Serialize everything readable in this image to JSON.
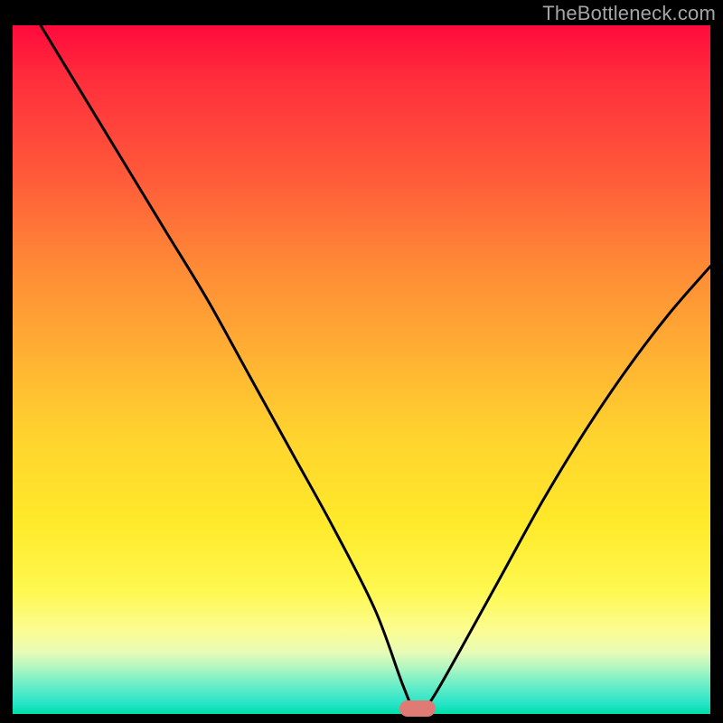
{
  "watermark": {
    "text": "TheBottleneck.com"
  },
  "chart_data": {
    "type": "line",
    "title": "",
    "xlabel": "",
    "ylabel": "",
    "xlim": [
      0,
      1
    ],
    "ylim": [
      0,
      1
    ],
    "grid": false,
    "legend": false,
    "background_gradient_meaning": "bottleneck-severity (red=high, green=none)",
    "marker": {
      "x": 0.58,
      "y": 0.0,
      "shape": "pill",
      "color": "#e07a74"
    },
    "series": [
      {
        "name": "bottleneck-curve",
        "x": [
          0.04,
          0.1,
          0.16,
          0.22,
          0.28,
          0.34,
          0.4,
          0.46,
          0.52,
          0.56,
          0.58,
          0.6,
          0.64,
          0.7,
          0.76,
          0.82,
          0.88,
          0.94,
          1.0
        ],
        "y": [
          1.0,
          0.9,
          0.8,
          0.7,
          0.6,
          0.49,
          0.38,
          0.27,
          0.15,
          0.04,
          0.0,
          0.02,
          0.09,
          0.2,
          0.31,
          0.41,
          0.5,
          0.58,
          0.65
        ]
      }
    ]
  }
}
